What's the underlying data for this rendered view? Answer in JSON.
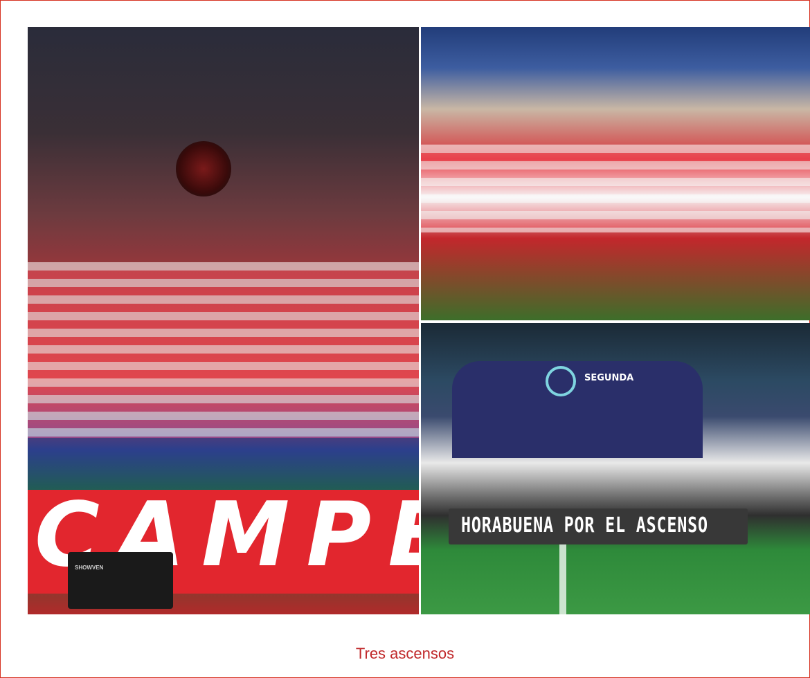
{
  "caption": {
    "text": "Tres ascensos",
    "color": "#c0282a"
  },
  "frame": {
    "border_color": "#d6301f"
  },
  "photos": {
    "left": {
      "alt": "",
      "banner_text": "CAMPEON",
      "device_label": "SHOWVEN"
    },
    "top_right": {
      "alt": ""
    },
    "bottom_right": {
      "alt": "",
      "arch_text": "SEGUNDA",
      "sign_text": "HORABUENA POR EL ASCENSO"
    }
  }
}
